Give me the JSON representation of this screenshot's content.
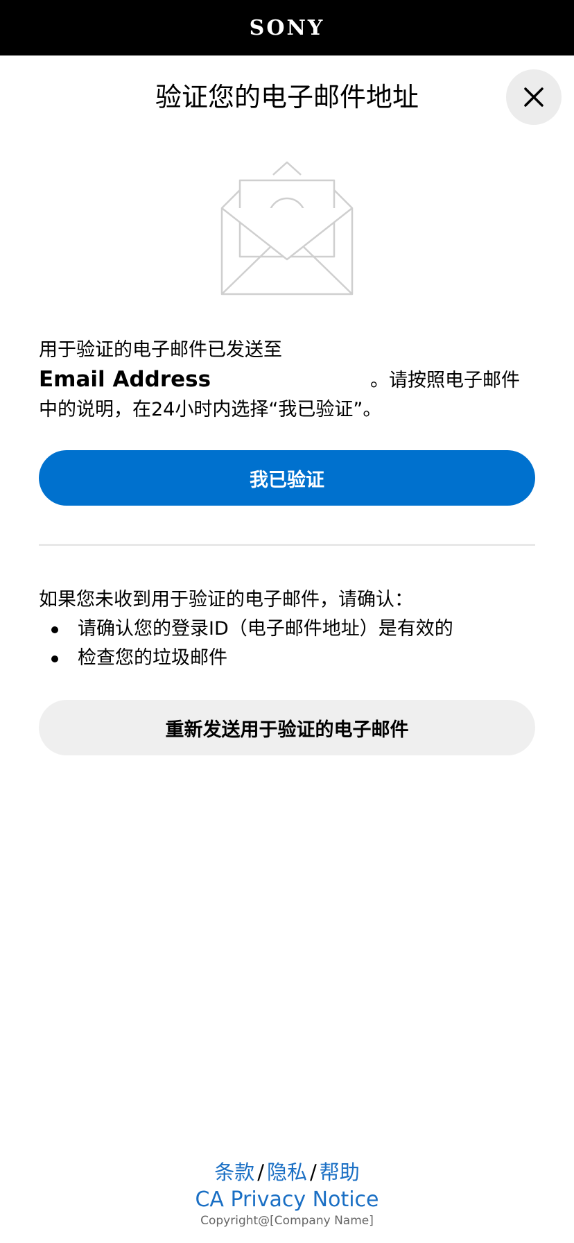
{
  "header": {
    "logo_text": "SONY"
  },
  "dialog": {
    "title": "验证您的电子邮件地址",
    "close_icon": "close-icon",
    "illustration_icon": "envelope-check-icon"
  },
  "message": {
    "line_before_email": "用于验证的电子邮件已发送至",
    "email": "Email Address",
    "line_after_email": "。请按照电子邮件中的说明，在24小时内选择“我已验证”。"
  },
  "primary_button": {
    "label": "我已验证",
    "color": "#0071ce"
  },
  "help": {
    "intro": "如果您未收到用于验证的电子邮件，请确认：",
    "items": [
      "请确认您的登录ID（电子邮件地址）是有效的",
      "检查您的垃圾邮件"
    ]
  },
  "secondary_button": {
    "label": "重新发送用于验证的电子邮件"
  },
  "footer": {
    "links": [
      "条款",
      "隐私",
      "帮助"
    ],
    "separator": "/",
    "privacy_notice": "CA Privacy Notice",
    "copyright": "Copyright@[Company Name]",
    "link_color": "#1a6fc4"
  }
}
